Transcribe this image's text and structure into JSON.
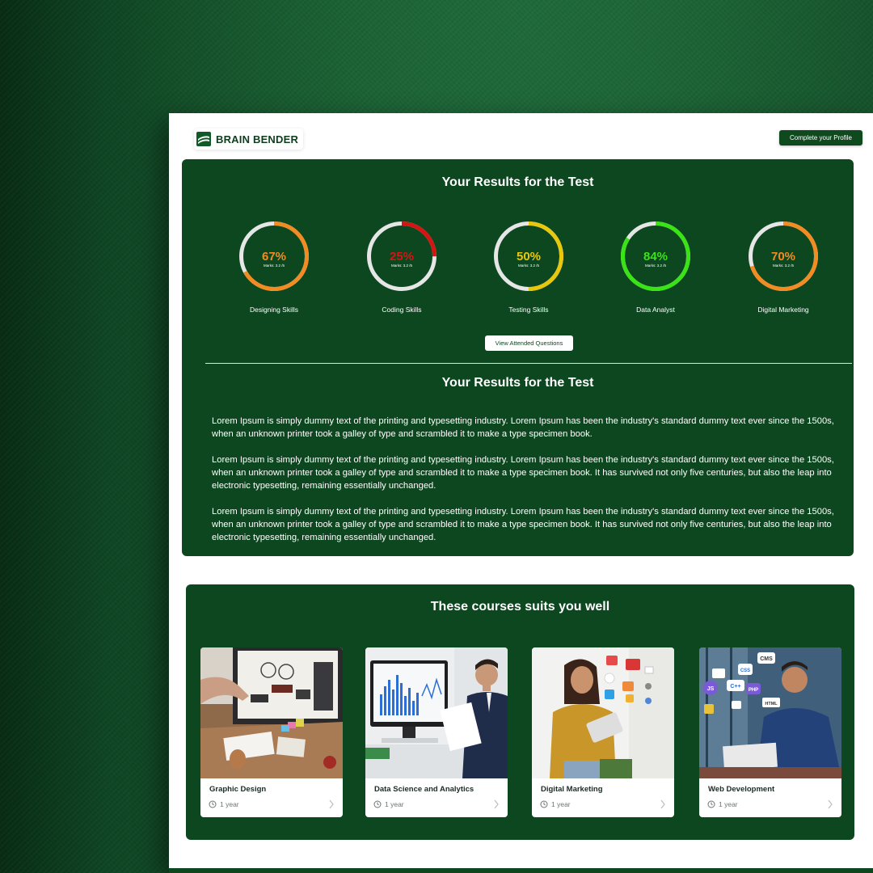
{
  "header": {
    "brand": "BRAIN BENDER",
    "profile_button": "Complete your Profile"
  },
  "results": {
    "title": "Your Results for the Test",
    "gauges": [
      {
        "percent_text": "67%",
        "value": 0.67,
        "marks": "Marks: 3.2 /5",
        "label": "Designing Skills",
        "color": "#f28c22"
      },
      {
        "percent_text": "25%",
        "value": 0.25,
        "marks": "Marks: 3.2 /5",
        "label": "Coding Skills",
        "color": "#d51414"
      },
      {
        "percent_text": "50%",
        "value": 0.5,
        "marks": "Marks: 3.2 /5",
        "label": "Testing Skills",
        "color": "#e8c80c"
      },
      {
        "percent_text": "84%",
        "value": 0.84,
        "marks": "Marks: 3.2 /5",
        "label": "Data Analyst",
        "color": "#39e316"
      },
      {
        "percent_text": "70%",
        "value": 0.7,
        "marks": "Marks: 3.2 /5",
        "label": "Digital Marketing",
        "color": "#f28c22"
      }
    ],
    "view_button": "View Attended Questions",
    "title2": "Your Results for the Test",
    "paragraphs": [
      "Lorem Ipsum is simply dummy text of the printing and typesetting industry. Lorem Ipsum has been the industry's standard dummy text ever since the 1500s, when an unknown printer took a galley of type and scrambled it to make a type specimen book.",
      "Lorem Ipsum is simply dummy text of the printing and typesetting industry. Lorem Ipsum has been the industry's standard dummy text ever since the 1500s, when an unknown printer took a galley of type and scrambled it to make a type specimen book. It has survived not only five centuries, but also the leap into electronic typesetting, remaining essentially unchanged.",
      "Lorem Ipsum is simply dummy text of the printing and typesetting industry. Lorem Ipsum has been the industry's standard dummy text ever since the 1500s, when an unknown printer took a galley of type and scrambled it to make a type specimen book. It has survived not only five centuries, but also the leap into electronic typesetting, remaining essentially unchanged."
    ]
  },
  "courses": {
    "title": "These courses suits you well",
    "items": [
      {
        "title": "Graphic Design",
        "duration": "1 year"
      },
      {
        "title": "Data Science and Analytics",
        "duration": "1 year"
      },
      {
        "title": "Digital Marketing",
        "duration": "1 year"
      },
      {
        "title": "Web Development",
        "duration": "1 year",
        "tags": [
          "CMS",
          "CSS",
          "C++",
          "PHP",
          "JS",
          "HTML"
        ]
      }
    ]
  },
  "colors": {
    "panel": "#0d4720",
    "track": "#e6e6e6",
    "background": "#17572d"
  }
}
